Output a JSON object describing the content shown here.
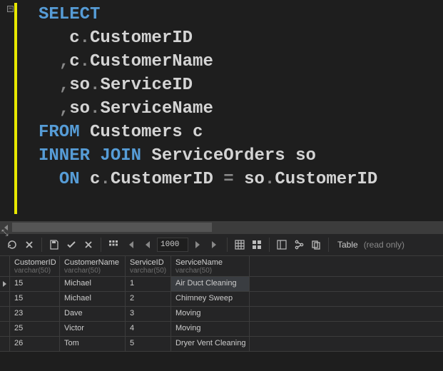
{
  "sql": {
    "tokens": [
      [
        {
          "t": "SELECT",
          "c": "kw"
        }
      ],
      [
        {
          "t": "   c",
          "c": "id"
        },
        {
          "t": ".",
          "c": "op"
        },
        {
          "t": "CustomerID",
          "c": "id"
        }
      ],
      [
        {
          "t": "  ",
          "c": "id"
        },
        {
          "t": ",",
          "c": "op"
        },
        {
          "t": "c",
          "c": "id"
        },
        {
          "t": ".",
          "c": "op"
        },
        {
          "t": "CustomerName",
          "c": "id"
        }
      ],
      [
        {
          "t": "  ",
          "c": "id"
        },
        {
          "t": ",",
          "c": "op"
        },
        {
          "t": "so",
          "c": "id"
        },
        {
          "t": ".",
          "c": "op"
        },
        {
          "t": "ServiceID",
          "c": "id"
        }
      ],
      [
        {
          "t": "  ",
          "c": "id"
        },
        {
          "t": ",",
          "c": "op"
        },
        {
          "t": "so",
          "c": "id"
        },
        {
          "t": ".",
          "c": "op"
        },
        {
          "t": "ServiceName",
          "c": "id"
        }
      ],
      [
        {
          "t": "FROM",
          "c": "kw"
        },
        {
          "t": " Customers c",
          "c": "id"
        }
      ],
      [
        {
          "t": "INNER",
          "c": "kw"
        },
        {
          "t": " ",
          "c": "id"
        },
        {
          "t": "JOIN",
          "c": "kw"
        },
        {
          "t": " ServiceOrders so",
          "c": "id"
        }
      ],
      [
        {
          "t": "  ",
          "c": "id"
        },
        {
          "t": "ON",
          "c": "kw"
        },
        {
          "t": " c",
          "c": "id"
        },
        {
          "t": ".",
          "c": "op"
        },
        {
          "t": "CustomerID ",
          "c": "id"
        },
        {
          "t": "=",
          "c": "op"
        },
        {
          "t": " so",
          "c": "id"
        },
        {
          "t": ".",
          "c": "op"
        },
        {
          "t": "CustomerID",
          "c": "id"
        }
      ]
    ]
  },
  "toolbar": {
    "page_size": "1000",
    "tab_label": "Table",
    "status": "(read only)"
  },
  "grid": {
    "columns": [
      {
        "name": "CustomerID",
        "type": "varchar(50)"
      },
      {
        "name": "CustomerName",
        "type": "varchar(50)"
      },
      {
        "name": "ServiceID",
        "type": "varchar(50)"
      },
      {
        "name": "ServiceName",
        "type": "varchar(50)"
      }
    ],
    "rows": [
      [
        "15",
        "Michael",
        "1",
        "Air Duct Cleaning"
      ],
      [
        "15",
        "Michael",
        "2",
        "Chimney Sweep"
      ],
      [
        "23",
        "Dave",
        "3",
        "Moving"
      ],
      [
        "25",
        "Victor",
        "4",
        "Moving"
      ],
      [
        "26",
        "Tom",
        "5",
        "Dryer Vent Cleaning"
      ]
    ],
    "selected_row": 0
  }
}
